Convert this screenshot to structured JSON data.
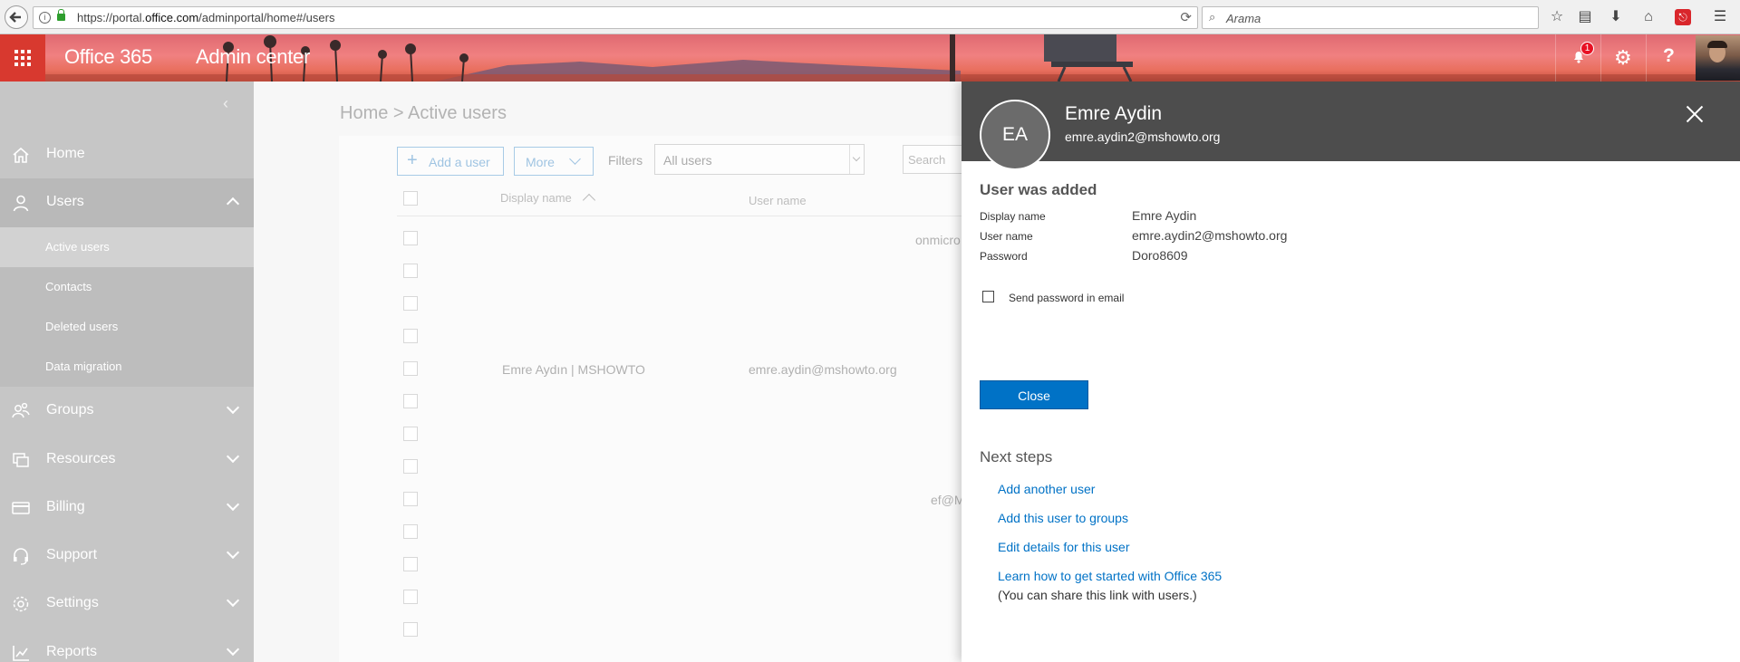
{
  "browser": {
    "url_prefix": "https://portal.",
    "url_domain": "office.com",
    "url_path": "/adminportal/home#/users",
    "search_placeholder": "Arama"
  },
  "header": {
    "brand": "Office 365",
    "app_title": "Admin center",
    "notification_count": "1",
    "help_glyph": "?",
    "accent_color": "#d8392f"
  },
  "nav": {
    "items": [
      {
        "label": "Home",
        "icon": "home-icon"
      },
      {
        "label": "Users",
        "icon": "user-icon"
      },
      {
        "label": "Groups",
        "icon": "groups-icon"
      },
      {
        "label": "Resources",
        "icon": "resources-icon"
      },
      {
        "label": "Billing",
        "icon": "billing-icon"
      },
      {
        "label": "Support",
        "icon": "headset-icon"
      },
      {
        "label": "Settings",
        "icon": "gear-icon"
      },
      {
        "label": "Reports",
        "icon": "reports-icon"
      }
    ],
    "users_sub": [
      "Active users",
      "Contacts",
      "Deleted users",
      "Data migration"
    ]
  },
  "main": {
    "breadcrumb": "Home > Active users",
    "add_user": "Add a user",
    "more": "More",
    "filters_label": "Filters",
    "filter_value": "All users",
    "search_placeholder": "Search",
    "col_display_name": "Display name",
    "col_user_name": "User name",
    "row_display": "Emre Aydın | MSHOWTO",
    "row_user": "emre.aydin@mshowto.org",
    "partial_onmicro": "onmicro",
    "partial_ef": "ef@M"
  },
  "panel": {
    "initials": "EA",
    "name": "Emre Aydin",
    "email": "emre.aydin2@mshowto.org",
    "added_title": "User was added",
    "labels": {
      "display_name": "Display name",
      "user_name": "User name",
      "password": "Password"
    },
    "values": {
      "display_name": "Emre Aydin",
      "user_name": "emre.aydin2@mshowto.org",
      "password": "Doro8609"
    },
    "send_password": "Send password in email",
    "close_button": "Close",
    "next_steps_title": "Next steps",
    "links": [
      "Add another user",
      "Add this user to groups",
      "Edit details for this user",
      "Learn how to get started with Office 365"
    ],
    "note": "(You can share this link with users.)",
    "primary_color": "#0072c6"
  }
}
